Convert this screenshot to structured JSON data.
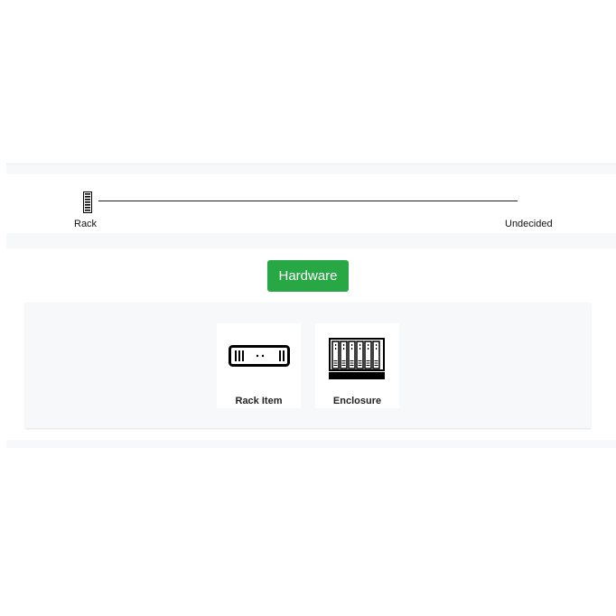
{
  "timeline": {
    "start_label": "Rack",
    "end_label": "Undecided",
    "start_icon": "rack-icon"
  },
  "category_button": {
    "label": "Hardware",
    "color": "#28a745"
  },
  "options": [
    {
      "label": "Rack Item",
      "icon": "rack-item-icon"
    },
    {
      "label": "Enclosure",
      "icon": "enclosure-icon"
    }
  ]
}
